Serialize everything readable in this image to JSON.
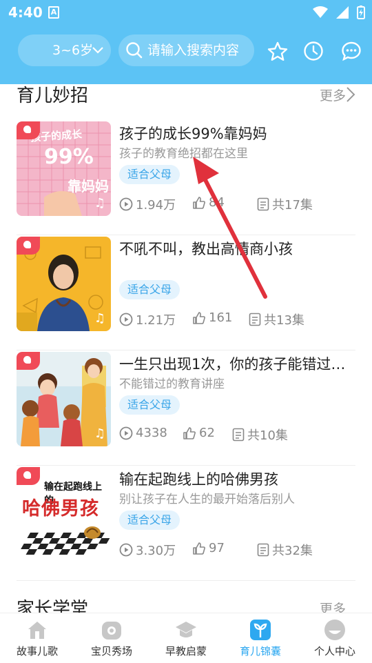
{
  "status_bar": {
    "time": "4:40",
    "notif_icon": "A"
  },
  "header": {
    "age_selector": "3~6岁",
    "search_placeholder": "请输入搜索内容",
    "icons": [
      "star-icon",
      "history-clock-icon",
      "message-icon"
    ],
    "bg_color": "#5cc3f5"
  },
  "section1": {
    "title": "育儿妙招",
    "more": "更多",
    "items": [
      {
        "title": "孩子的成长99%靠妈妈",
        "subtitle": "孩子的教育绝招都在这里",
        "tag": "适合父母",
        "plays": "1.94万",
        "likes": "84",
        "episodes": "共17集"
      },
      {
        "title": "不吼不叫，教出高情商小孩",
        "subtitle": "",
        "tag": "适合父母",
        "plays": "1.21万",
        "likes": "161",
        "episodes": "共13集"
      },
      {
        "title": "一生只出现1次，你的孩子能错过…",
        "subtitle": "不能错过的教育讲座",
        "tag": "适合父母",
        "plays": "4338",
        "likes": "62",
        "episodes": "共10集"
      },
      {
        "title": "输在起跑线上的哈佛男孩",
        "subtitle": "别让孩子在人生的最开始落后别人",
        "tag": "适合父母",
        "plays": "3.30万",
        "likes": "97",
        "episodes": "共32集"
      }
    ]
  },
  "thumb_text": {
    "t1_line1": "孩子的成长",
    "t1_line2": "99%",
    "t1_line3": "靠妈妈",
    "t4_line1": "输在起跑线上的",
    "t4_line2": "哈佛男孩"
  },
  "section2": {
    "title": "家长学堂",
    "more": "更多"
  },
  "bottom_nav": {
    "items": [
      {
        "label": "故事儿歌",
        "active": false
      },
      {
        "label": "宝贝秀场",
        "active": false
      },
      {
        "label": "早教启蒙",
        "active": false
      },
      {
        "label": "育儿锦囊",
        "active": true
      },
      {
        "label": "个人中心",
        "active": false
      }
    ]
  }
}
